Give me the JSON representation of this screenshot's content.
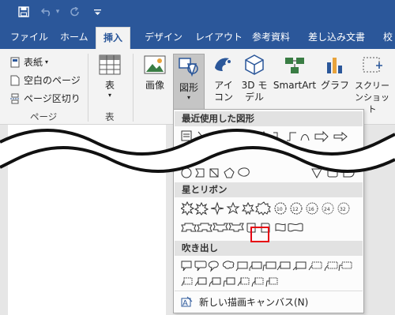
{
  "titlebar": {
    "quick_access": [
      {
        "name": "save-icon",
        "glyph": "💾"
      },
      {
        "name": "undo-icon",
        "glyph": "↶"
      },
      {
        "name": "undo-dropdown-icon",
        "glyph": "▾"
      },
      {
        "name": "redo-icon",
        "glyph": "↻"
      },
      {
        "name": "customize-qat-icon",
        "glyph": "="
      }
    ]
  },
  "tabs": {
    "file": "ファイル",
    "home": "ホーム",
    "insert": "挿入",
    "design": "デザイン",
    "layout": "レイアウト",
    "references": "参考資料",
    "mailings": "差し込み文書",
    "review_partial": "校"
  },
  "ribbon": {
    "pages": {
      "cover": "表紙",
      "blank": "空白のページ",
      "break": "ページ区切り",
      "group": "ページ"
    },
    "table": {
      "label": "表",
      "group": "表"
    },
    "picture": "画像",
    "shapes": "図形",
    "icons": "アイコン",
    "model3d": "3D モデル",
    "smartart": "SmartArt",
    "chart": "グラフ",
    "screenshot": "スクリーンショット"
  },
  "dropdown": {
    "recent_header": "最近使用した図形",
    "stars_header": "星とリボン",
    "callouts_header": "吹き出し",
    "new_canvas": "新しい描画キャンバス(N)"
  },
  "colors": {
    "accent": "#2b579a",
    "highlight": "#e60012",
    "ribbon_bg": "#f3f3f3"
  }
}
